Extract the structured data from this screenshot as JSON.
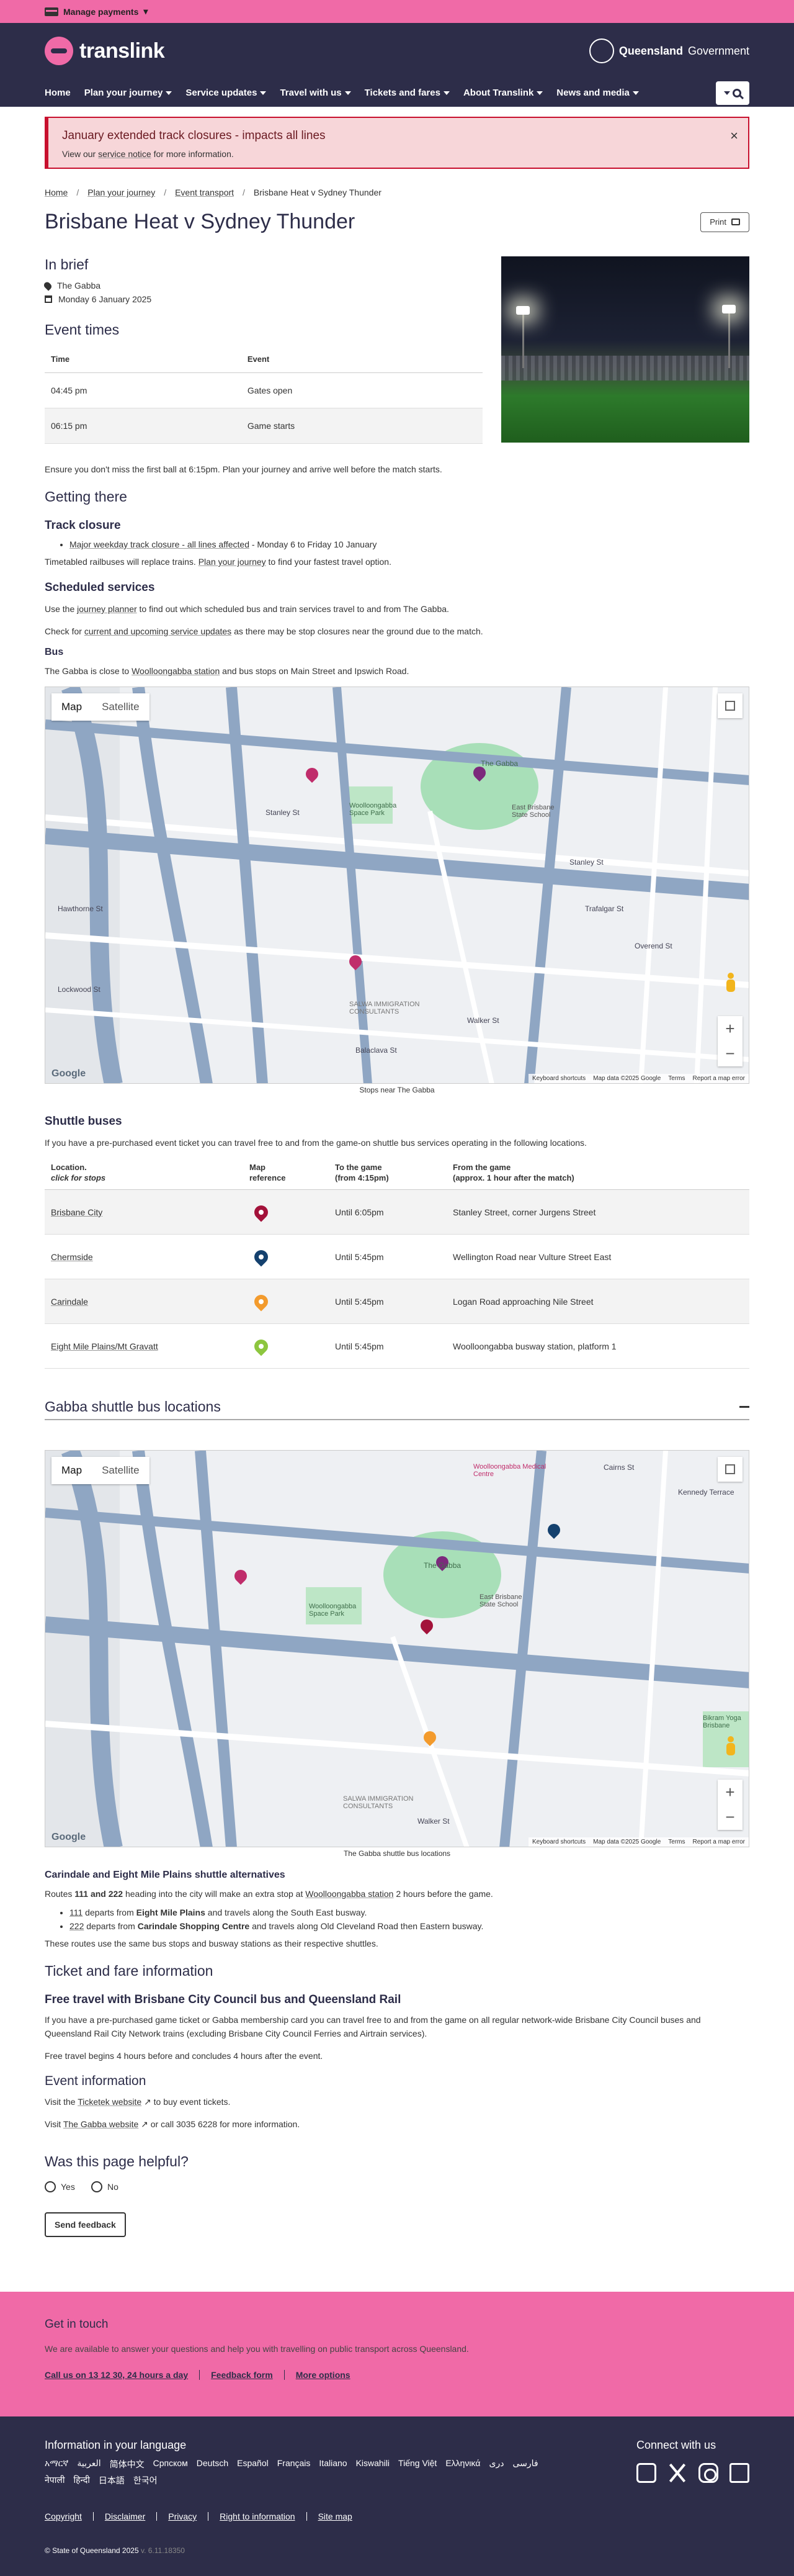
{
  "topbar": {
    "manage_label": "Manage payments",
    "caret": "▾"
  },
  "header": {
    "logo_text": "translink",
    "gov_bold": "Queensland",
    "gov_text": "Government",
    "nav": [
      {
        "label": "Home",
        "has_menu": false
      },
      {
        "label": "Plan your journey",
        "has_menu": true
      },
      {
        "label": "Service updates",
        "has_menu": true
      },
      {
        "label": "Travel with us",
        "has_menu": true
      },
      {
        "label": "Tickets and fares",
        "has_menu": true
      },
      {
        "label": "About Translink",
        "has_menu": true
      },
      {
        "label": "News and media",
        "has_menu": true
      }
    ]
  },
  "alert": {
    "title": "January extended track closures - impacts all lines",
    "text_before": "View our",
    "link": "service notice",
    "text_after": "for more information.",
    "close": "×"
  },
  "breadcrumb": [
    "Home",
    "Plan your journey",
    "Event transport",
    "Brisbane Heat v Sydney Thunder"
  ],
  "page_title": "Brisbane Heat v Sydney Thunder",
  "print_label": "Print",
  "in_brief": {
    "heading": "In brief",
    "venue": "The Gabba",
    "date": "Monday 6 January 2025"
  },
  "event_times": {
    "heading": "Event times",
    "columns": [
      "Time",
      "Event"
    ],
    "rows": [
      [
        "04:45 pm",
        "Gates open"
      ],
      [
        "06:15 pm",
        "Game starts"
      ]
    ]
  },
  "intro": "Ensure you don't miss the first ball at 6:15pm. Plan your journey and arrive well before the match starts.",
  "getting_there": {
    "heading": "Getting there",
    "track_heading": "Track closure",
    "track_link": "Major weekday track closure - all lines affected",
    "track_suffix": " - Monday 6 to Friday 10 January",
    "track_p_before": "Timetabled railbuses will replace trains.",
    "track_p_link": "Plan your journey",
    "track_p_after": "to find your fastest travel option.",
    "sched_heading": "Scheduled services",
    "sched_p1_before": "Use the",
    "sched_p1_link": "journey planner",
    "sched_p1_after": "to find out which scheduled bus and train services travel to and from The Gabba.",
    "sched_p2_before": "Check for",
    "sched_p2_link": "current and upcoming service updates",
    "sched_p2_after": "as there may be stop closures near the ground due to the match.",
    "bus_heading": "Bus",
    "bus_before": "The Gabba is close to",
    "bus_link": "Woolloongabba station",
    "bus_after": "and bus stops on Main Street and Ipswich Road."
  },
  "map1": {
    "tab_map": "Map",
    "tab_satellite": "Satellite",
    "labels": {
      "gabba": "The Gabba",
      "park": "Woolloongabba Space Park",
      "school": "East Brisbane State School",
      "stanley": "Stanley St",
      "trafalgar": "Trafalgar St",
      "overend": "Overend St",
      "walker": "Walker St",
      "balaclava": "Balaclava St",
      "hawthorne": "Hawthorne St",
      "lockwood": "Lockwood St",
      "immigration": "SALWA IMMIGRATION CONSULTANTS"
    },
    "google": "Google",
    "attribution": [
      "Keyboard shortcuts",
      "Map data ©2025 Google",
      "Terms",
      "Report a map error"
    ],
    "caption": "Stops near The Gabba"
  },
  "shuttle": {
    "heading": "Shuttle buses",
    "intro": "If you have a pre-purchased event ticket you can travel free to and from the game-on shuttle bus services operating in the following locations.",
    "columns": {
      "location": "Location.",
      "location_sub": "click for stops",
      "mapref": "Map",
      "mapref2": "reference",
      "to": "To the game",
      "to2": "(from 4:15pm)",
      "from": "From the game",
      "from2": "(approx. 1 hour after the match)"
    },
    "rows": [
      {
        "location": "Brisbane City",
        "color": "#a3123a",
        "to": "Until 6:05pm",
        "from": "Stanley Street, corner Jurgens Street"
      },
      {
        "location": "Chermside",
        "color": "#14416e",
        "to": "Until 5:45pm",
        "from": "Wellington Road near Vulture Street East"
      },
      {
        "location": "Carindale",
        "color": "#f39b2d",
        "to": "Until 5:45pm",
        "from": "Logan Road approaching Nile Street"
      },
      {
        "location": "Eight Mile Plains/Mt Gravatt",
        "color": "#8dc63f",
        "to": "Until 5:45pm",
        "from": "Woolloongabba busway station, platform 1"
      }
    ]
  },
  "shuttle_locations": {
    "heading": "Gabba shuttle bus locations",
    "map_labels": {
      "gabba": "The Gabba",
      "medical": "Woolloongabba Medical Centre",
      "school": "East Brisbane State School",
      "park": "Woolloongabba Space Park",
      "bikram": "Bikram Yoga Brisbane",
      "immigration": "SALWA IMMIGRATION CONSULTANTS",
      "walker": "Walker St",
      "cairns": "Cairns St",
      "kennedy": "Kennedy Terrace"
    },
    "caption": "The Gabba shuttle bus locations"
  },
  "alternatives": {
    "heading": "Carindale and Eight Mile Plains shuttle alternatives",
    "p_before": "Routes",
    "p_routes": "111 and 222",
    "p_mid": "heading into the city will make an extra stop at",
    "p_link": "Woolloongabba station",
    "p_after": "2 hours before the game.",
    "items": [
      {
        "route": "111",
        "mid": " departs from ",
        "place": "Eight Mile Plains",
        "end": " and travels along the South East busway."
      },
      {
        "route": "222",
        "mid": " departs from ",
        "place": "Carindale Shopping Centre",
        "end": " and travels along Old Cleveland Road then Eastern busway."
      }
    ],
    "note": "These routes use the same bus stops and busway stations as their respective shuttles."
  },
  "ticket_fare": {
    "heading": "Ticket and fare information",
    "sub": "Free travel with Brisbane City Council bus and Queensland Rail",
    "p1": "If you have a pre-purchased game ticket or Gabba membership card you can travel free to and from the game on all regular network-wide Brisbane City Council buses and Queensland Rail City Network trains (excluding Brisbane City Council Ferries and Airtrain services).",
    "p2": "Free travel begins 4 hours before and concludes 4 hours after the event."
  },
  "event_info": {
    "heading": "Event information",
    "p1_before": "Visit the",
    "p1_link": "Ticketek website",
    "p1_after": "to buy event tickets.",
    "p2_before": "Visit",
    "p2_link": "The Gabba website",
    "p2_after": "or call 3035 6228 for more information."
  },
  "helpful": {
    "heading": "Was this page helpful?",
    "yes": "Yes",
    "no": "No",
    "button": "Send feedback"
  },
  "get_in_touch": {
    "heading": "Get in touch",
    "text": "We are available to answer your questions and help you with travelling on public transport across Queensland.",
    "links": [
      "Call us on 13 12 30, 24 hours a day",
      "Feedback form",
      "More options"
    ]
  },
  "footer": {
    "lang_heading": "Information in your language",
    "languages": [
      "አማርኛ",
      "العربية",
      "简体中文",
      "Српском",
      "Deutsch",
      "Español",
      "Français",
      "Italiano",
      "Kiswahili",
      "Tiếng Việt",
      "Ελληνικά",
      "دری",
      "فارسی",
      "नेपाली",
      "हिन्दी",
      "日本語",
      "한국어"
    ],
    "connect_heading": "Connect with us",
    "links": [
      "Copyright",
      "Disclaimer",
      "Privacy",
      "Right to information",
      "Site map"
    ],
    "copyright": "© State of Queensland 2025",
    "version": "v. 6.11.18350"
  },
  "colors": {
    "pink": "#f06aa7",
    "navy": "#2d2d49",
    "alert_red": "#c8102e"
  }
}
